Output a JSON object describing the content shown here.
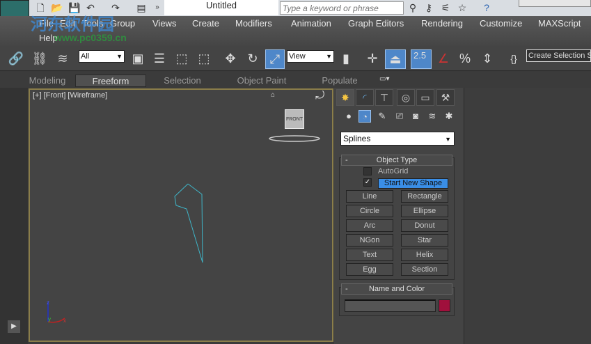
{
  "title_bar": {
    "title": "Untitled",
    "search_placeholder": "Type a keyword or phrase"
  },
  "menu": [
    "File",
    "Edit",
    "Tools",
    "Group",
    "Views",
    "Create",
    "Modifiers",
    "Animation",
    "Graph Editors",
    "Rendering",
    "Customize",
    "MAXScript",
    "Help"
  ],
  "toolbar": {
    "selection_filter": "All",
    "reference_coord": "View",
    "snap_value": "2.5",
    "named_selection": "Create Selection S"
  },
  "ribbon_tabs": [
    "Modeling",
    "Freeform",
    "Selection",
    "Object Paint",
    "Populate"
  ],
  "viewport": {
    "label": "[+] [Front] [Wireframe]",
    "viewcube": "FRONT",
    "axes": {
      "z": "z",
      "y": "y",
      "x": "x"
    }
  },
  "command_panel": {
    "category": "Splines",
    "object_type": {
      "title": "Object Type",
      "autogrid": "AutoGrid",
      "autogrid_checked": false,
      "start_new_shape": "Start New Shape",
      "start_new_shape_checked": true,
      "buttons": [
        "Line",
        "Rectangle",
        "Circle",
        "Ellipse",
        "Arc",
        "Donut",
        "NGon",
        "Star",
        "Text",
        "Helix",
        "Egg",
        "Section"
      ]
    },
    "name_color": {
      "title": "Name and Color",
      "name": "",
      "color": "#a0103c"
    },
    "collapse": "-"
  },
  "watermark": {
    "text": "河东软件园",
    "url": "www.pc0359.cn"
  },
  "colors": {
    "spline": "#3fb6c9",
    "viewport_border": "#8b7e4a",
    "accent": "#4e87c9"
  }
}
